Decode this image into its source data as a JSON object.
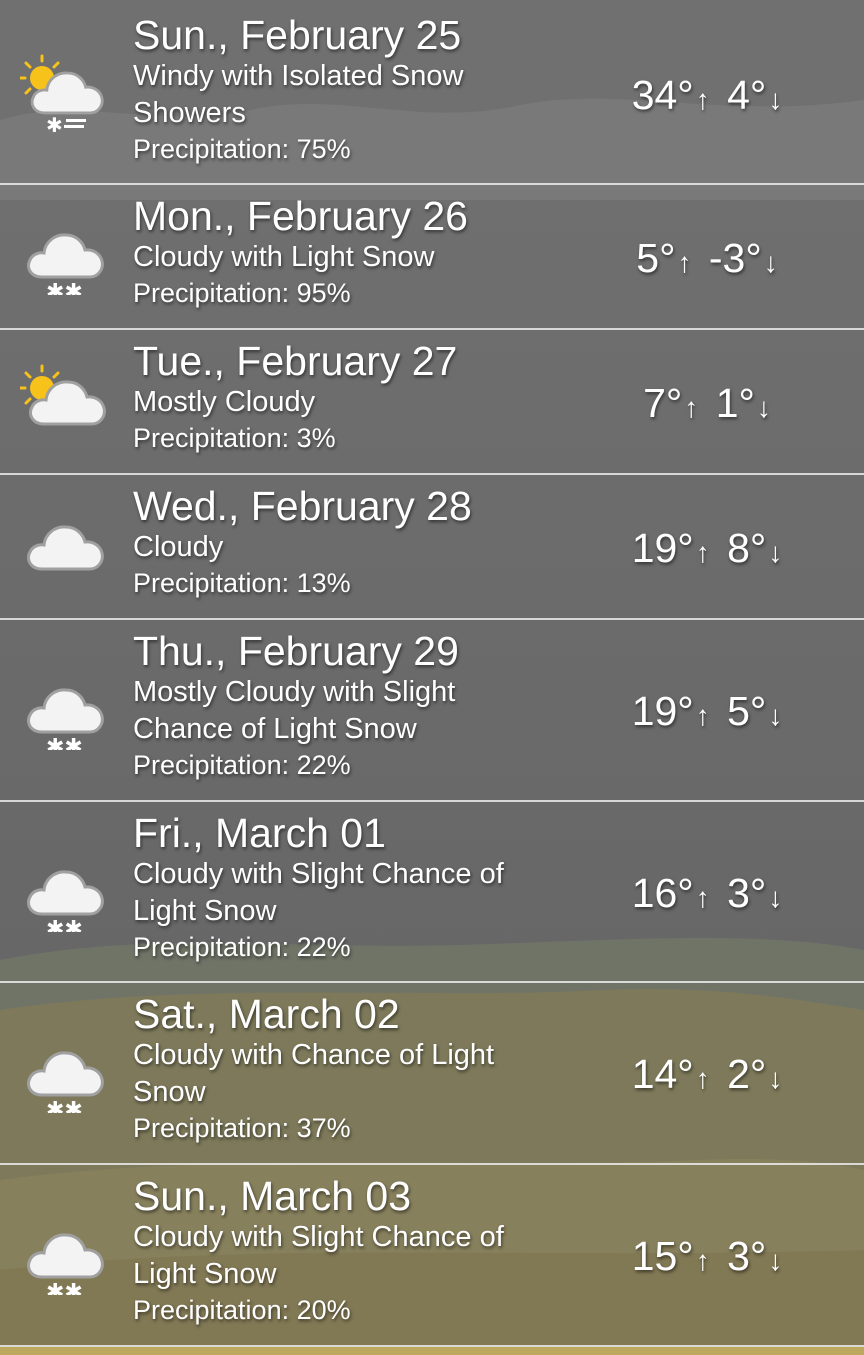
{
  "forecast": [
    {
      "date": "Sun., February 25",
      "description": "Windy with Isolated Snow Showers",
      "precipitation": "Precipitation: 75%",
      "high": "34°",
      "low": "4°",
      "icon": "sun-cloud-windy-snow-icon"
    },
    {
      "date": "Mon., February 26",
      "description": "Cloudy with Light Snow",
      "precipitation": "Precipitation: 95%",
      "high": "5°",
      "low": "-3°",
      "icon": "cloud-snow-icon"
    },
    {
      "date": "Tue., February 27",
      "description": "Mostly Cloudy",
      "precipitation": "Precipitation: 3%",
      "high": "7°",
      "low": "1°",
      "icon": "sun-cloud-icon"
    },
    {
      "date": "Wed., February 28",
      "description": "Cloudy",
      "precipitation": "Precipitation: 13%",
      "high": "19°",
      "low": "8°",
      "icon": "cloud-icon"
    },
    {
      "date": "Thu., February 29",
      "description": "Mostly Cloudy with Slight Chance of Light Snow",
      "precipitation": "Precipitation: 22%",
      "high": "19°",
      "low": "5°",
      "icon": "cloud-snow-icon"
    },
    {
      "date": "Fri., March 01",
      "description": "Cloudy with Slight Chance of Light Snow",
      "precipitation": "Precipitation: 22%",
      "high": "16°",
      "low": "3°",
      "icon": "cloud-snow-icon"
    },
    {
      "date": "Sat., March 02",
      "description": "Cloudy with Chance of Light Snow",
      "precipitation": "Precipitation: 37%",
      "high": "14°",
      "low": "2°",
      "icon": "cloud-snow-icon"
    },
    {
      "date": "Sun., March 03",
      "description": "Cloudy with Slight Chance of Light Snow",
      "precipitation": "Precipitation: 20%",
      "high": "15°",
      "low": "3°",
      "icon": "cloud-snow-icon"
    }
  ],
  "arrows": {
    "up": "↑",
    "down": "↓"
  },
  "colors": {
    "row_overlay": "#4b4b4b",
    "separator": "#ebebeb",
    "sun": "#f7c21a",
    "cloud": "#f3f3f3",
    "cloud_outline": "#9a9a9a",
    "hill": "#c7b66a",
    "tree": "#2e8a5a",
    "trunk": "#5b4536"
  }
}
